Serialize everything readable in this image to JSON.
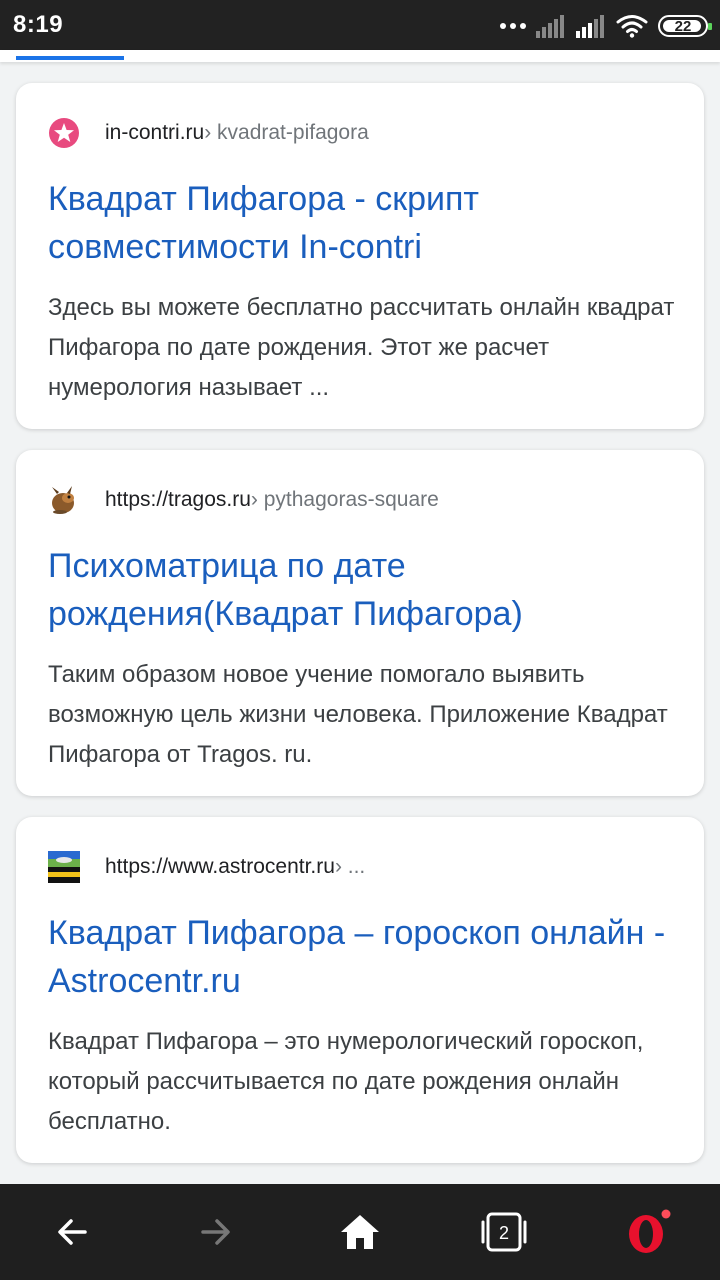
{
  "status_bar": {
    "time": "8:19",
    "battery": "22"
  },
  "results": [
    {
      "domain": "in-contri.ru",
      "breadcrumb": " › kvadrat-pifagora",
      "title": "Квадрат Пифагора - скрипт совместимости In-contri",
      "snippet": "Здесь вы можете бесплатно рассчитать онлайн квадрат Пифагора по дате рождения. Этот же расчет нумерология называет ..."
    },
    {
      "domain": "https://tragos.ru",
      "breadcrumb": " › pythagoras-square",
      "title": "Психоматрица по дате рождения(Квадрат Пифагора)",
      "snippet": "Таким образом новое учение помогало выявить возможную цель жизни человека. Приложение Квадрат Пифагора от Tragos. ru."
    },
    {
      "domain": "https://www.astrocentr.ru",
      "breadcrumb": " › ...",
      "title": "Квадрат Пифагора – гороскоп онлайн - Astrocentr.ru",
      "snippet": "Квадрат Пифагора – это нумерологический гороскоп, который рассчитывается по дате рождения онлайн бесплатно."
    }
  ],
  "nav": {
    "tabs_count": "2"
  },
  "colors": {
    "link": "#1a5ebd",
    "accent": "#1a73e8",
    "opera_red": "#e8112d"
  }
}
